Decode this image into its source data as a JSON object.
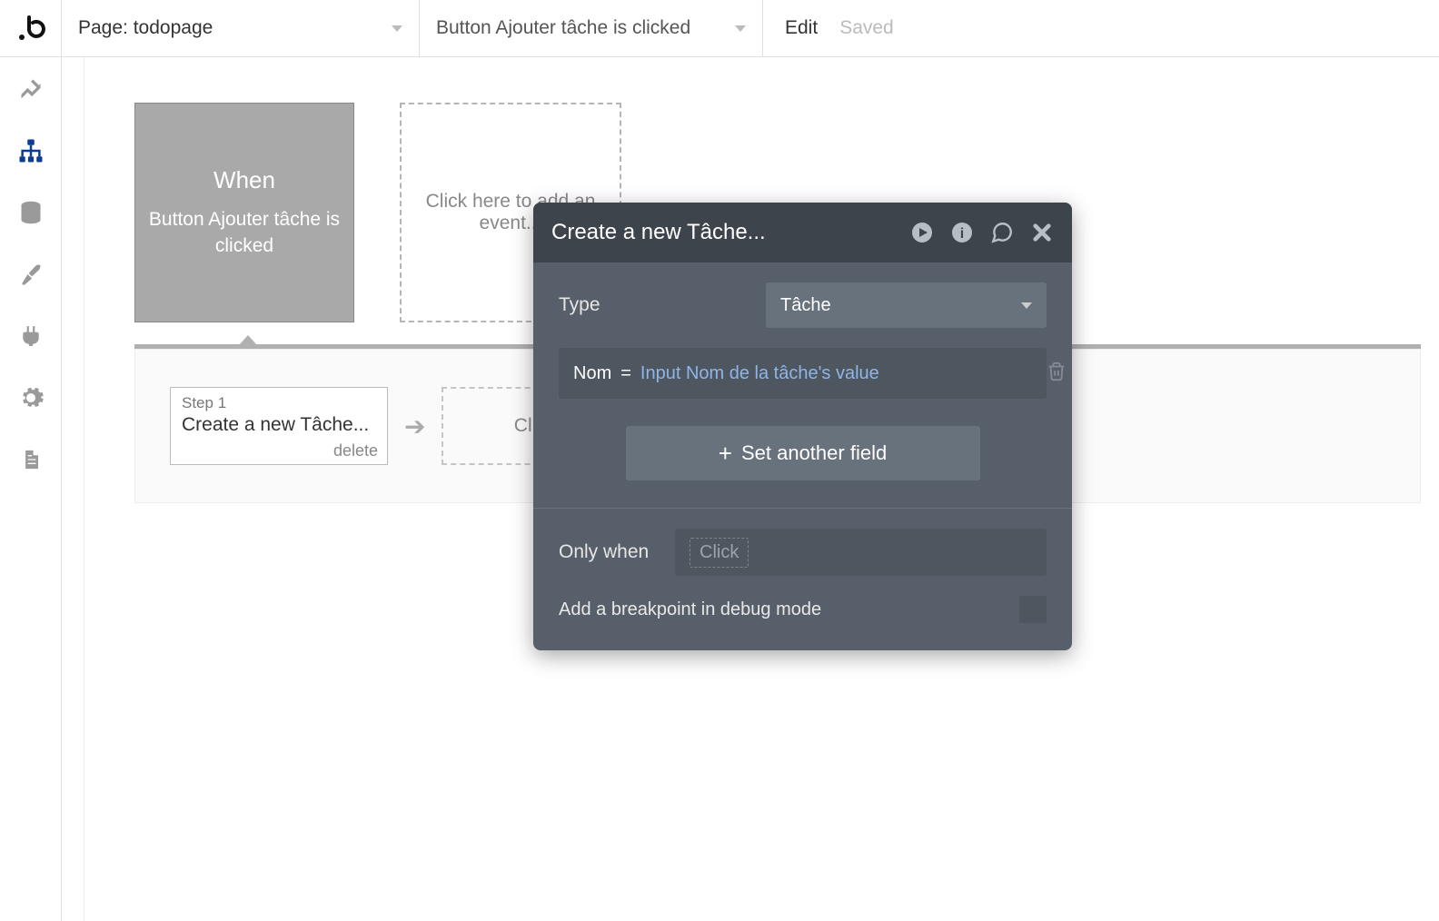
{
  "header": {
    "page_label": "Page: todopage",
    "workflow_label": "Button Ajouter tâche is clicked",
    "edit": "Edit",
    "saved": "Saved"
  },
  "event": {
    "when": "When",
    "description": "Button Ajouter tâche is clicked"
  },
  "add_event_label": "Click here to add an event...",
  "step": {
    "label": "Step 1",
    "title": "Create a new Tâche...",
    "delete": "delete"
  },
  "add_step_label": "Click here",
  "panel": {
    "title": "Create a new Tâche...",
    "type_label": "Type",
    "type_value": "Tâche",
    "field_name": "Nom",
    "field_eq": "=",
    "field_value": "Input Nom de la tâche's value",
    "set_another": "Set another field",
    "only_when_label": "Only when",
    "only_when_placeholder": "Click",
    "breakpoint_label": "Add a breakpoint in debug mode"
  }
}
